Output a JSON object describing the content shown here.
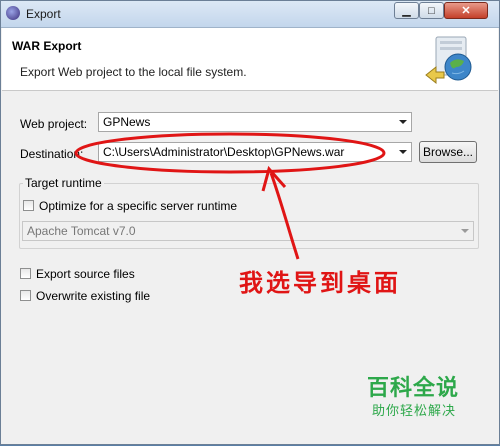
{
  "window": {
    "title": "Export"
  },
  "controls": {
    "minimize": "▁",
    "maximize": "□",
    "close": "✕"
  },
  "header": {
    "title": "WAR Export",
    "description": "Export Web project to the local file system."
  },
  "form": {
    "web_project_label": "Web project:",
    "web_project_value": "GPNews",
    "destination_label": "Destination:",
    "destination_value": "C:\\Users\\Administrator\\Desktop\\GPNews.war",
    "browse_label": "Browse..."
  },
  "target_runtime": {
    "group_label": "Target runtime",
    "optimize_label": "Optimize for a specific server runtime",
    "optimize_checked": false,
    "runtime_value": "Apache Tomcat v7.0"
  },
  "options": [
    {
      "label": "Export source files",
      "checked": false
    },
    {
      "label": "Overwrite existing file",
      "checked": false
    }
  ],
  "annotation": {
    "text": "我选导到桌面",
    "color": "#e01515"
  },
  "watermark": {
    "main": "百科全说",
    "sub": "助你轻松解决",
    "color": "#2da84a"
  }
}
